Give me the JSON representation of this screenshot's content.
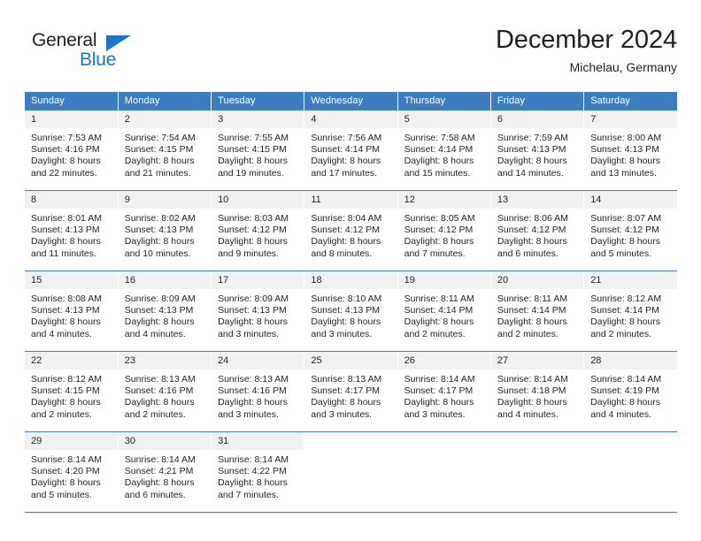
{
  "brand": {
    "name_part1": "General",
    "name_part2": "Blue",
    "triangle_color": "#1c76c5"
  },
  "header": {
    "title": "December 2024",
    "subtitle": "Michelau, Germany"
  },
  "theme": {
    "header_blue": "#3c7cbf",
    "daynum_bg": "#f1f1f1",
    "text": "#231f20"
  },
  "weekdays": [
    "Sunday",
    "Monday",
    "Tuesday",
    "Wednesday",
    "Thursday",
    "Friday",
    "Saturday"
  ],
  "weeks": [
    [
      {
        "day": "1",
        "sunrise": "Sunrise: 7:53 AM",
        "sunset": "Sunset: 4:16 PM",
        "daylight1": "Daylight: 8 hours",
        "daylight2": "and 22 minutes."
      },
      {
        "day": "2",
        "sunrise": "Sunrise: 7:54 AM",
        "sunset": "Sunset: 4:15 PM",
        "daylight1": "Daylight: 8 hours",
        "daylight2": "and 21 minutes."
      },
      {
        "day": "3",
        "sunrise": "Sunrise: 7:55 AM",
        "sunset": "Sunset: 4:15 PM",
        "daylight1": "Daylight: 8 hours",
        "daylight2": "and 19 minutes."
      },
      {
        "day": "4",
        "sunrise": "Sunrise: 7:56 AM",
        "sunset": "Sunset: 4:14 PM",
        "daylight1": "Daylight: 8 hours",
        "daylight2": "and 17 minutes."
      },
      {
        "day": "5",
        "sunrise": "Sunrise: 7:58 AM",
        "sunset": "Sunset: 4:14 PM",
        "daylight1": "Daylight: 8 hours",
        "daylight2": "and 15 minutes."
      },
      {
        "day": "6",
        "sunrise": "Sunrise: 7:59 AM",
        "sunset": "Sunset: 4:13 PM",
        "daylight1": "Daylight: 8 hours",
        "daylight2": "and 14 minutes."
      },
      {
        "day": "7",
        "sunrise": "Sunrise: 8:00 AM",
        "sunset": "Sunset: 4:13 PM",
        "daylight1": "Daylight: 8 hours",
        "daylight2": "and 13 minutes."
      }
    ],
    [
      {
        "day": "8",
        "sunrise": "Sunrise: 8:01 AM",
        "sunset": "Sunset: 4:13 PM",
        "daylight1": "Daylight: 8 hours",
        "daylight2": "and 11 minutes."
      },
      {
        "day": "9",
        "sunrise": "Sunrise: 8:02 AM",
        "sunset": "Sunset: 4:13 PM",
        "daylight1": "Daylight: 8 hours",
        "daylight2": "and 10 minutes."
      },
      {
        "day": "10",
        "sunrise": "Sunrise: 8:03 AM",
        "sunset": "Sunset: 4:12 PM",
        "daylight1": "Daylight: 8 hours",
        "daylight2": "and 9 minutes."
      },
      {
        "day": "11",
        "sunrise": "Sunrise: 8:04 AM",
        "sunset": "Sunset: 4:12 PM",
        "daylight1": "Daylight: 8 hours",
        "daylight2": "and 8 minutes."
      },
      {
        "day": "12",
        "sunrise": "Sunrise: 8:05 AM",
        "sunset": "Sunset: 4:12 PM",
        "daylight1": "Daylight: 8 hours",
        "daylight2": "and 7 minutes."
      },
      {
        "day": "13",
        "sunrise": "Sunrise: 8:06 AM",
        "sunset": "Sunset: 4:12 PM",
        "daylight1": "Daylight: 8 hours",
        "daylight2": "and 6 minutes."
      },
      {
        "day": "14",
        "sunrise": "Sunrise: 8:07 AM",
        "sunset": "Sunset: 4:12 PM",
        "daylight1": "Daylight: 8 hours",
        "daylight2": "and 5 minutes."
      }
    ],
    [
      {
        "day": "15",
        "sunrise": "Sunrise: 8:08 AM",
        "sunset": "Sunset: 4:13 PM",
        "daylight1": "Daylight: 8 hours",
        "daylight2": "and 4 minutes."
      },
      {
        "day": "16",
        "sunrise": "Sunrise: 8:09 AM",
        "sunset": "Sunset: 4:13 PM",
        "daylight1": "Daylight: 8 hours",
        "daylight2": "and 4 minutes."
      },
      {
        "day": "17",
        "sunrise": "Sunrise: 8:09 AM",
        "sunset": "Sunset: 4:13 PM",
        "daylight1": "Daylight: 8 hours",
        "daylight2": "and 3 minutes."
      },
      {
        "day": "18",
        "sunrise": "Sunrise: 8:10 AM",
        "sunset": "Sunset: 4:13 PM",
        "daylight1": "Daylight: 8 hours",
        "daylight2": "and 3 minutes."
      },
      {
        "day": "19",
        "sunrise": "Sunrise: 8:11 AM",
        "sunset": "Sunset: 4:14 PM",
        "daylight1": "Daylight: 8 hours",
        "daylight2": "and 2 minutes."
      },
      {
        "day": "20",
        "sunrise": "Sunrise: 8:11 AM",
        "sunset": "Sunset: 4:14 PM",
        "daylight1": "Daylight: 8 hours",
        "daylight2": "and 2 minutes."
      },
      {
        "day": "21",
        "sunrise": "Sunrise: 8:12 AM",
        "sunset": "Sunset: 4:14 PM",
        "daylight1": "Daylight: 8 hours",
        "daylight2": "and 2 minutes."
      }
    ],
    [
      {
        "day": "22",
        "sunrise": "Sunrise: 8:12 AM",
        "sunset": "Sunset: 4:15 PM",
        "daylight1": "Daylight: 8 hours",
        "daylight2": "and 2 minutes."
      },
      {
        "day": "23",
        "sunrise": "Sunrise: 8:13 AM",
        "sunset": "Sunset: 4:16 PM",
        "daylight1": "Daylight: 8 hours",
        "daylight2": "and 2 minutes."
      },
      {
        "day": "24",
        "sunrise": "Sunrise: 8:13 AM",
        "sunset": "Sunset: 4:16 PM",
        "daylight1": "Daylight: 8 hours",
        "daylight2": "and 3 minutes."
      },
      {
        "day": "25",
        "sunrise": "Sunrise: 8:13 AM",
        "sunset": "Sunset: 4:17 PM",
        "daylight1": "Daylight: 8 hours",
        "daylight2": "and 3 minutes."
      },
      {
        "day": "26",
        "sunrise": "Sunrise: 8:14 AM",
        "sunset": "Sunset: 4:17 PM",
        "daylight1": "Daylight: 8 hours",
        "daylight2": "and 3 minutes."
      },
      {
        "day": "27",
        "sunrise": "Sunrise: 8:14 AM",
        "sunset": "Sunset: 4:18 PM",
        "daylight1": "Daylight: 8 hours",
        "daylight2": "and 4 minutes."
      },
      {
        "day": "28",
        "sunrise": "Sunrise: 8:14 AM",
        "sunset": "Sunset: 4:19 PM",
        "daylight1": "Daylight: 8 hours",
        "daylight2": "and 4 minutes."
      }
    ],
    [
      {
        "day": "29",
        "sunrise": "Sunrise: 8:14 AM",
        "sunset": "Sunset: 4:20 PM",
        "daylight1": "Daylight: 8 hours",
        "daylight2": "and 5 minutes."
      },
      {
        "day": "30",
        "sunrise": "Sunrise: 8:14 AM",
        "sunset": "Sunset: 4:21 PM",
        "daylight1": "Daylight: 8 hours",
        "daylight2": "and 6 minutes."
      },
      {
        "day": "31",
        "sunrise": "Sunrise: 8:14 AM",
        "sunset": "Sunset: 4:22 PM",
        "daylight1": "Daylight: 8 hours",
        "daylight2": "and 7 minutes."
      },
      {
        "day": "",
        "sunrise": "",
        "sunset": "",
        "daylight1": "",
        "daylight2": ""
      },
      {
        "day": "",
        "sunrise": "",
        "sunset": "",
        "daylight1": "",
        "daylight2": ""
      },
      {
        "day": "",
        "sunrise": "",
        "sunset": "",
        "daylight1": "",
        "daylight2": ""
      },
      {
        "day": "",
        "sunrise": "",
        "sunset": "",
        "daylight1": "",
        "daylight2": ""
      }
    ]
  ]
}
